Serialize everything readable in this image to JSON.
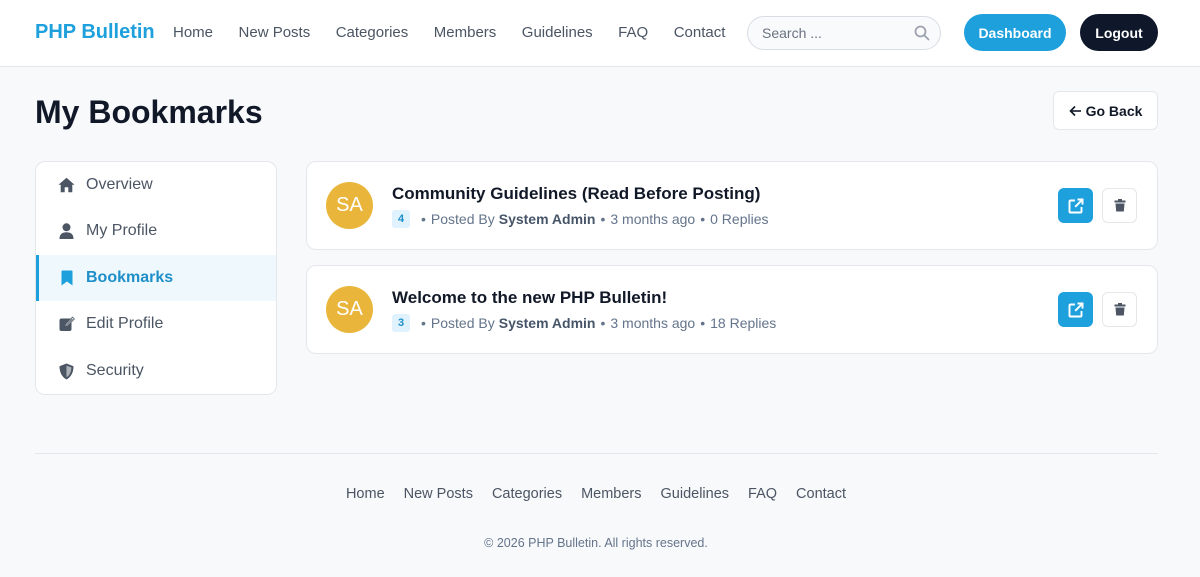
{
  "brand": "PHP Bulletin",
  "nav": [
    "Home",
    "New Posts",
    "Categories",
    "Members",
    "Guidelines",
    "FAQ",
    "Contact"
  ],
  "search": {
    "placeholder": "Search ..."
  },
  "header_buttons": {
    "dashboard": "Dashboard",
    "logout": "Logout"
  },
  "page": {
    "title": "My Bookmarks",
    "go_back": "Go Back"
  },
  "sidebar": [
    {
      "label": "Overview",
      "icon": "home-icon"
    },
    {
      "label": "My Profile",
      "icon": "user-icon"
    },
    {
      "label": "Bookmarks",
      "icon": "bookmark-icon",
      "active": true
    },
    {
      "label": "Edit Profile",
      "icon": "edit-icon"
    },
    {
      "label": "Security",
      "icon": "shield-icon"
    }
  ],
  "bookmarks": [
    {
      "initials": "SA",
      "title": "Community Guidelines (Read Before Posting)",
      "badge": "4",
      "posted_by_label": "Posted By",
      "author": "System Admin",
      "time": "3 months ago",
      "replies": "0 Replies"
    },
    {
      "initials": "SA",
      "title": "Welcome to the new PHP Bulletin!",
      "badge": "3",
      "posted_by_label": "Posted By",
      "author": "System Admin",
      "time": "3 months ago",
      "replies": "18 Replies"
    }
  ],
  "footer": {
    "nav": [
      "Home",
      "New Posts",
      "Categories",
      "Members",
      "Guidelines",
      "FAQ",
      "Contact"
    ],
    "copyright": "© 2026 PHP Bulletin. All rights reserved."
  },
  "colors": {
    "accent": "#1ea0dc",
    "dark": "#0f172a",
    "avatar": "#eab53b"
  }
}
